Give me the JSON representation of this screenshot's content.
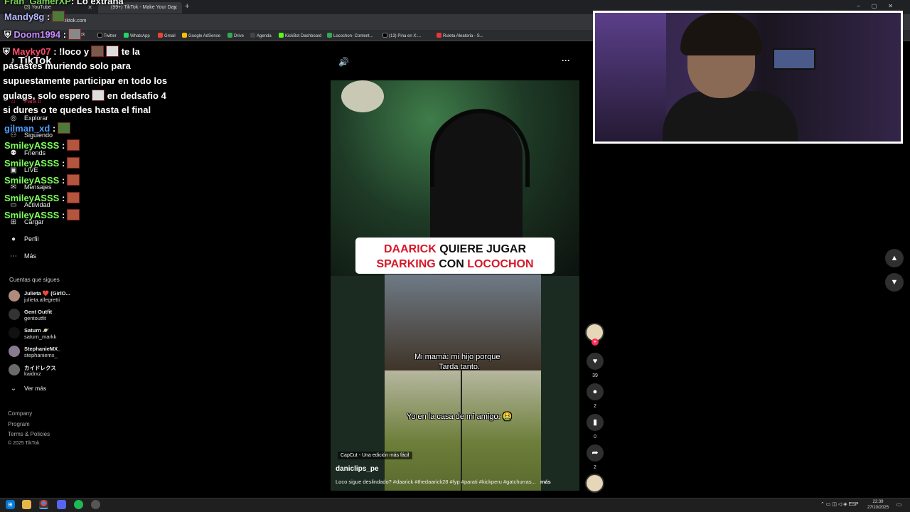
{
  "browser": {
    "tabs": [
      {
        "label": "(3) YouTube"
      },
      {
        "label": "(99+) TikTok - Make Your Day"
      }
    ],
    "url": "tiktok.com",
    "bookmarks": [
      "ick",
      "Twitter",
      "WhatsApp",
      "Gmail",
      "Google AdSense",
      "Drive",
      "Agenda",
      "KickBot Dashboard",
      "Locochon- Content...",
      "(13) Pina en X:...",
      "Ruleta Aleatoria - S..."
    ]
  },
  "tiktok": {
    "logo": "TikTok",
    "nav": [
      "Para ti",
      "Explorar",
      "Siguiendo",
      "Friends",
      "LIVE",
      "Mensajes",
      "Actividad",
      "Cargar",
      "Perfil",
      "Más"
    ],
    "following_title": "Cuentas que sigues",
    "following": [
      {
        "name": "Julieta ❤️ (GirlO...",
        "handle": "julieta.allegretti"
      },
      {
        "name": "Gent Outfit",
        "handle": "gentoutfit"
      },
      {
        "name": "Saturn 🪐",
        "handle": "saturn_markk"
      },
      {
        "name": "StephanieMX_",
        "handle": "stephaniemx_"
      },
      {
        "name": "カイドレクス",
        "handle": "kaidrxz"
      }
    ],
    "see_more": "Ver más",
    "footer": [
      "Company",
      "Program",
      "Terms & Policies",
      "© 2025 TikTok"
    ]
  },
  "chat": {
    "lines": [
      {
        "user": "Fran_GamerXP",
        "text": ": Lo extraña",
        "color": "#7cd35a"
      },
      {
        "user": "Mandy8g",
        "text": ":",
        "color": "#b7b7ff"
      },
      {
        "user": "Doom1994",
        "text": ":",
        "color": "#c88cff"
      },
      {
        "user": "Mayky07",
        "text": ": !loco y",
        "color": "#ff4d6d"
      },
      {
        "user": "gilman_xd",
        "text": ":",
        "color": "#4d9dff"
      },
      {
        "user": "SmileyASSS",
        "text": ":",
        "color": "#7cff5a"
      },
      {
        "user": "SmileyASSS",
        "text": ":",
        "color": "#7cff5a"
      },
      {
        "user": "SmileyASSS",
        "text": ":",
        "color": "#7cff5a"
      },
      {
        "user": "SmileyASSS",
        "text": ":",
        "color": "#7cff5a"
      },
      {
        "user": "SmileyASSS",
        "text": ":",
        "color": "#7cff5a"
      }
    ],
    "mayky_tail": "te la",
    "mayky_cont": [
      "pasastes muriendo solo para",
      "supuestamente participar en todo los"
    ],
    "mayky_cont3a": "gulags, solo espero",
    "mayky_cont3b": "en dedsafio 4",
    "mayky_cont4": "si dures o te quedes hasta el final"
  },
  "video": {
    "title_line1_red": "DAARICK",
    "title_line1_black": "QUIERE JUGAR",
    "title_line2_red1": "SPARKING",
    "title_line2_black": "CON",
    "title_line2_red2": "LOCOCHON",
    "subtitle1": "Mi mamá: mi hijo porque",
    "subtitle2": "Tarda tanto.",
    "subtitle3": "Yo en la casa de mi amigo: 🤮",
    "capcut": "CapCut - Una edición más fácil",
    "author": "daniclips_pe",
    "description": "Loco sigue deslindado? #daarick #thedaarick28 #fyp #parati #kickperu #gatchurras...",
    "more": "más",
    "likes": "39",
    "comments": "2",
    "saves": "0",
    "shares": "2"
  },
  "taskbar": {
    "lang": "ESP",
    "time": "22:39",
    "date": "27/10/2025"
  },
  "colors": {
    "tiktok_red": "#fe2c55",
    "title_red": "#d6192a"
  }
}
